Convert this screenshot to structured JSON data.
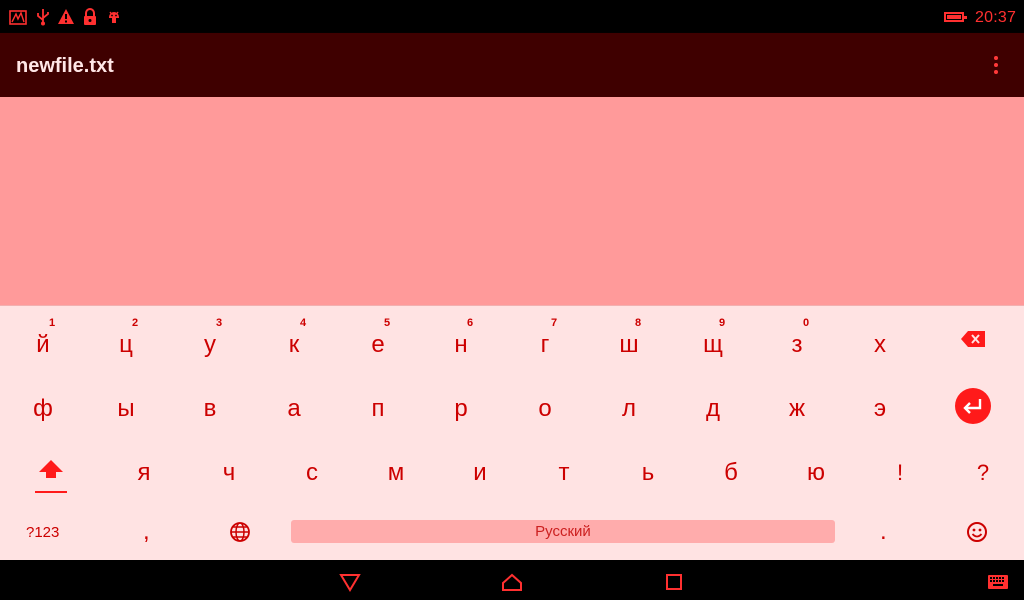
{
  "status_bar": {
    "time": "20:37",
    "icons": [
      "notification-icon",
      "usb-icon",
      "warning-icon",
      "lock-icon",
      "android-debug-icon"
    ],
    "battery_level": 1.0
  },
  "app_bar": {
    "title": "newfile.txt",
    "overflow_icon": "more-vert-icon"
  },
  "editor": {
    "content": ""
  },
  "keyboard": {
    "row1": [
      {
        "label": "й",
        "hint": "1"
      },
      {
        "label": "ц",
        "hint": "2"
      },
      {
        "label": "у",
        "hint": "3"
      },
      {
        "label": "к",
        "hint": "4"
      },
      {
        "label": "е",
        "hint": "5"
      },
      {
        "label": "н",
        "hint": "6"
      },
      {
        "label": "г",
        "hint": "7"
      },
      {
        "label": "ш",
        "hint": "8"
      },
      {
        "label": "щ",
        "hint": "9"
      },
      {
        "label": "з",
        "hint": "0"
      },
      {
        "label": "х",
        "hint": ""
      }
    ],
    "row2": [
      {
        "label": "ф"
      },
      {
        "label": "ы"
      },
      {
        "label": "в"
      },
      {
        "label": "а"
      },
      {
        "label": "п"
      },
      {
        "label": "р"
      },
      {
        "label": "о"
      },
      {
        "label": "л"
      },
      {
        "label": "д"
      },
      {
        "label": "ж"
      },
      {
        "label": "э"
      }
    ],
    "row3": [
      {
        "label": "я"
      },
      {
        "label": "ч"
      },
      {
        "label": "с"
      },
      {
        "label": "м"
      },
      {
        "label": "и"
      },
      {
        "label": "т"
      },
      {
        "label": "ь"
      },
      {
        "label": "б"
      },
      {
        "label": "ю"
      },
      {
        "label": "!"
      },
      {
        "label": "?"
      }
    ],
    "symbols_label": "?123",
    "comma_label": ",",
    "space_label": "Русский",
    "period_label": ".",
    "icons": {
      "backspace": "backspace-icon",
      "enter": "enter-icon",
      "shift": "shift-icon",
      "language": "globe-icon",
      "emoji": "emoji-icon"
    }
  },
  "nav_bar": {
    "buttons": [
      "back-icon",
      "home-icon",
      "recents-icon",
      "keyboard-switch-icon"
    ]
  },
  "colors": {
    "accent": "#ff1a1a",
    "app_bar": "#3f0000",
    "editor_bg": "#ff9a9a",
    "keyboard_bg": "#ffe3e3",
    "key_text": "#cc0000"
  }
}
